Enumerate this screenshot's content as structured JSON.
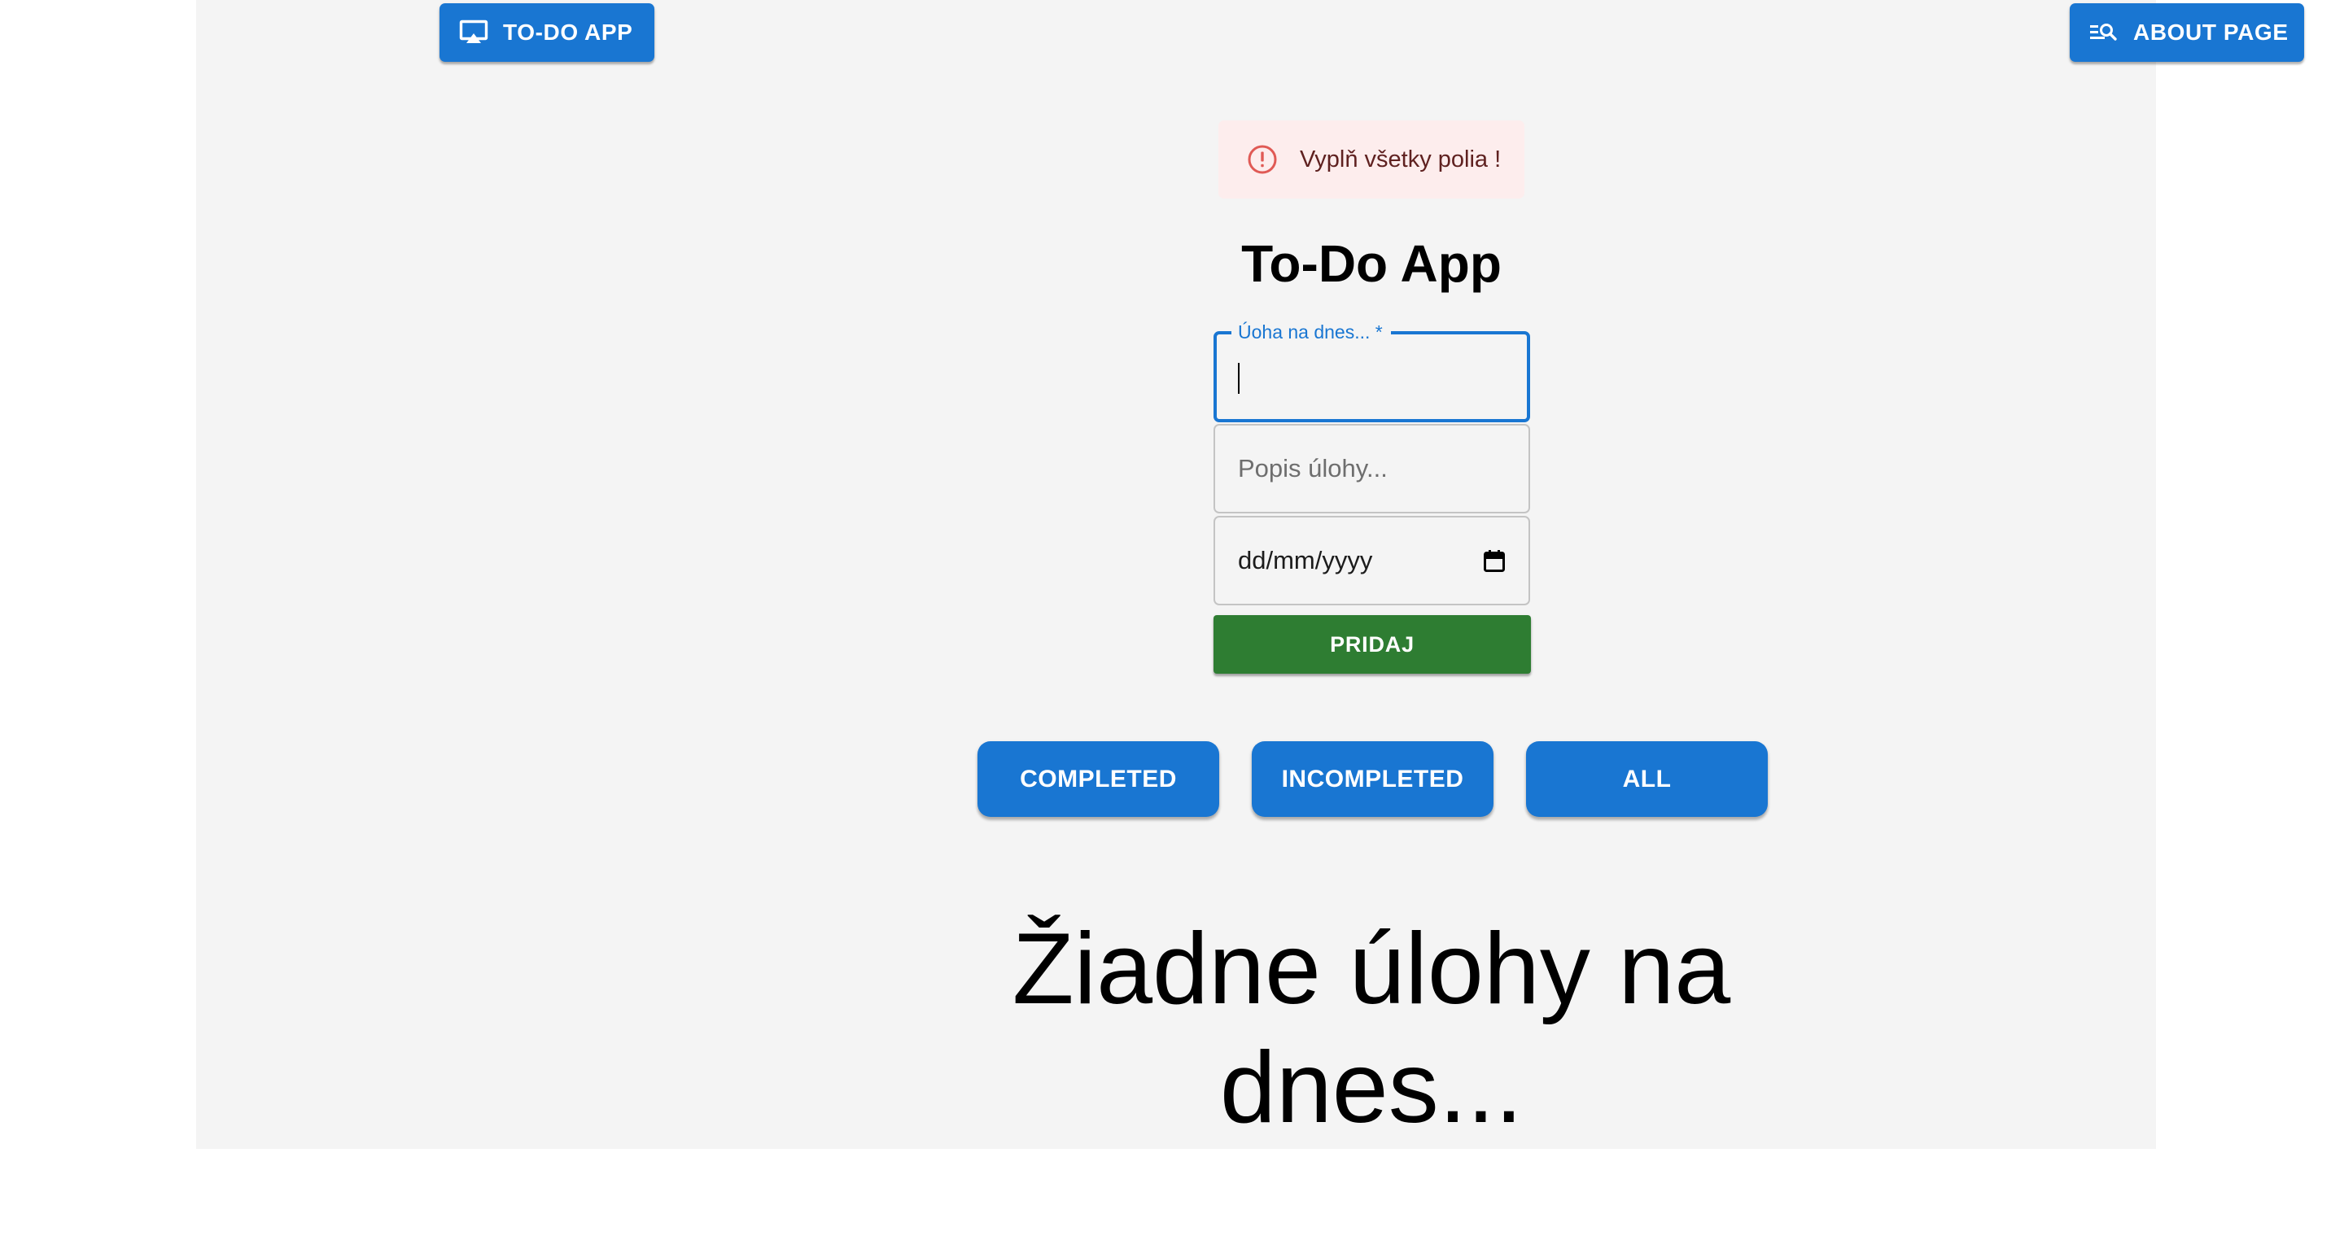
{
  "nav": {
    "todo_app_label": "TO-DO APP",
    "todo_app_icon": "airplay-icon",
    "about_page_label": "ABOUT PAGE",
    "about_page_icon": "manage-search-icon"
  },
  "alert": {
    "text": "Vyplň všetky polia !",
    "icon": "error-outline-icon",
    "severity": "error"
  },
  "form": {
    "title": "To-Do App",
    "task_label": "Úoha na dnes... *",
    "task_value": "",
    "description_placeholder": "Popis úlohy...",
    "date_placeholder": "dd/mm/yyyy",
    "date_icon": "calendar-icon",
    "add_label": "PRIDAJ"
  },
  "filters": {
    "completed_label": "COMPLETED",
    "incompleted_label": "INCOMPLETED",
    "all_label": "ALL"
  },
  "empty_state": {
    "message": "Žiadne úlohy na dnes..."
  },
  "colors": {
    "primary": "#1976d2",
    "success": "#2e7d32",
    "alert_background": "#fdeded",
    "alert_icon": "#d32f2f",
    "alert_text": "#5f2120",
    "panel_background": "#f4f4f4"
  }
}
